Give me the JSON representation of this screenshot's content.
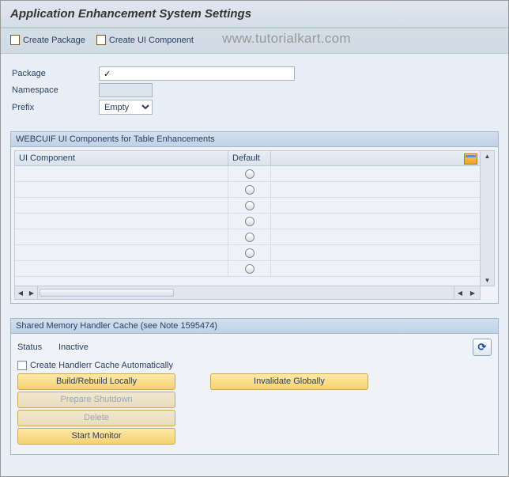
{
  "header": {
    "title": "Application Enhancement System Settings"
  },
  "toolbar": {
    "create_package": "Create Package",
    "create_ui_component": "Create UI Component"
  },
  "watermark": "www.tutorialkart.com",
  "form": {
    "package_label": "Package",
    "package_value": "",
    "namespace_label": "Namespace",
    "namespace_value": "",
    "prefix_label": "Prefix",
    "prefix_value": "Empty"
  },
  "table_panel": {
    "title": "WEBCUIF UI Components for Table Enhancements",
    "col_component": "UI Component",
    "col_default": "Default",
    "rows": [
      {
        "component": "",
        "default": false
      },
      {
        "component": "",
        "default": false
      },
      {
        "component": "",
        "default": false
      },
      {
        "component": "",
        "default": false
      },
      {
        "component": "",
        "default": false
      },
      {
        "component": "",
        "default": false
      },
      {
        "component": "",
        "default": false
      }
    ]
  },
  "cache_panel": {
    "title": "Shared Memory Handler Cache (see Note 1595474)",
    "status_label": "Status",
    "status_value": "Inactive",
    "checkbox_label": "Create Handlerr Cache Automatically",
    "btn_build": "Build/Rebuild Locally",
    "btn_invalidate": "Invalidate Globally",
    "btn_prepare": "Prepare Shutdown",
    "btn_delete": "Delete",
    "btn_monitor": "Start Monitor"
  }
}
